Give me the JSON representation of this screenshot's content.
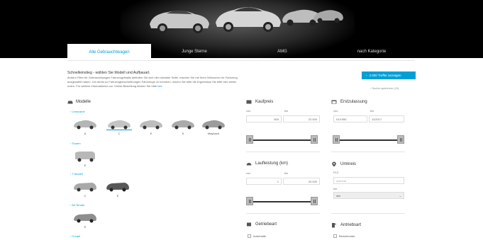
{
  "tabs": [
    {
      "label": "Alle Gebrauchtwagen",
      "active": true
    },
    {
      "label": "Junge Sterne",
      "active": false
    },
    {
      "label": "AMG",
      "active": false
    },
    {
      "label": "nach Kategorie",
      "active": false
    }
  ],
  "intro": {
    "title": "Schnelleinstieg - wählen Sie Modell und Aufbauart.",
    "text": "Ändern Filter für Gebrauchtwagen Fahrzeugdetails befinden Sie sich hier nächster Seite, machen Sie mit Ihren Wünschen Ihr Fahrzeug ausgewählt haben. Um direkt zu Fahrzeugbeschreibungen Fahrzeuge zu kommen, nutzen Sie bitte die Ergebnisse Sie bitte hier weiter unten. Für weitere Informationen zur Online-Bestellung klicken Sie bitte",
    "link": "hier"
  },
  "hits_button": {
    "label": "2.000 Treffer anzeigen",
    "icon": "chevron-right-icon"
  },
  "save_search": "Suche speichern (10)",
  "models": {
    "title": "Modelle",
    "categories": [
      {
        "label": "Limousine",
        "items": [
          "A",
          "C",
          "E",
          "S",
          "Maybach"
        ],
        "selected": 1
      },
      {
        "label": "Touren",
        "items": [
          "E"
        ],
        "selected": -1
      },
      {
        "label": "T-Modell",
        "items": [
          "C",
          "E"
        ],
        "selected": -1
      },
      {
        "label": "All-Terrain",
        "items": [
          "E"
        ],
        "selected": -1
      },
      {
        "label": "Coupé",
        "items": [],
        "selected": -1
      }
    ]
  },
  "price": {
    "title": "Kaufpreis",
    "from_label": "von",
    "to_label": "bis",
    "from": "500",
    "to": "22.000"
  },
  "registration": {
    "title": "Erstzulassung",
    "from_label": "von",
    "to_label": "bis",
    "from": "01/1950",
    "to": "11/2017"
  },
  "mileage": {
    "title": "Laufleistung (km)",
    "from_label": "von",
    "to_label": "bis",
    "from": "1",
    "to": "20.000"
  },
  "radius": {
    "title": "Umkreis",
    "zip_label": "PLZ",
    "zip_placeholder": "optional",
    "radius_label": "km",
    "radius_value": "alle"
  },
  "gearbox": {
    "title": "Getriebeart",
    "option": "Automatik"
  },
  "drive": {
    "title": "Antriebsart",
    "option": "Benzinmotor"
  }
}
